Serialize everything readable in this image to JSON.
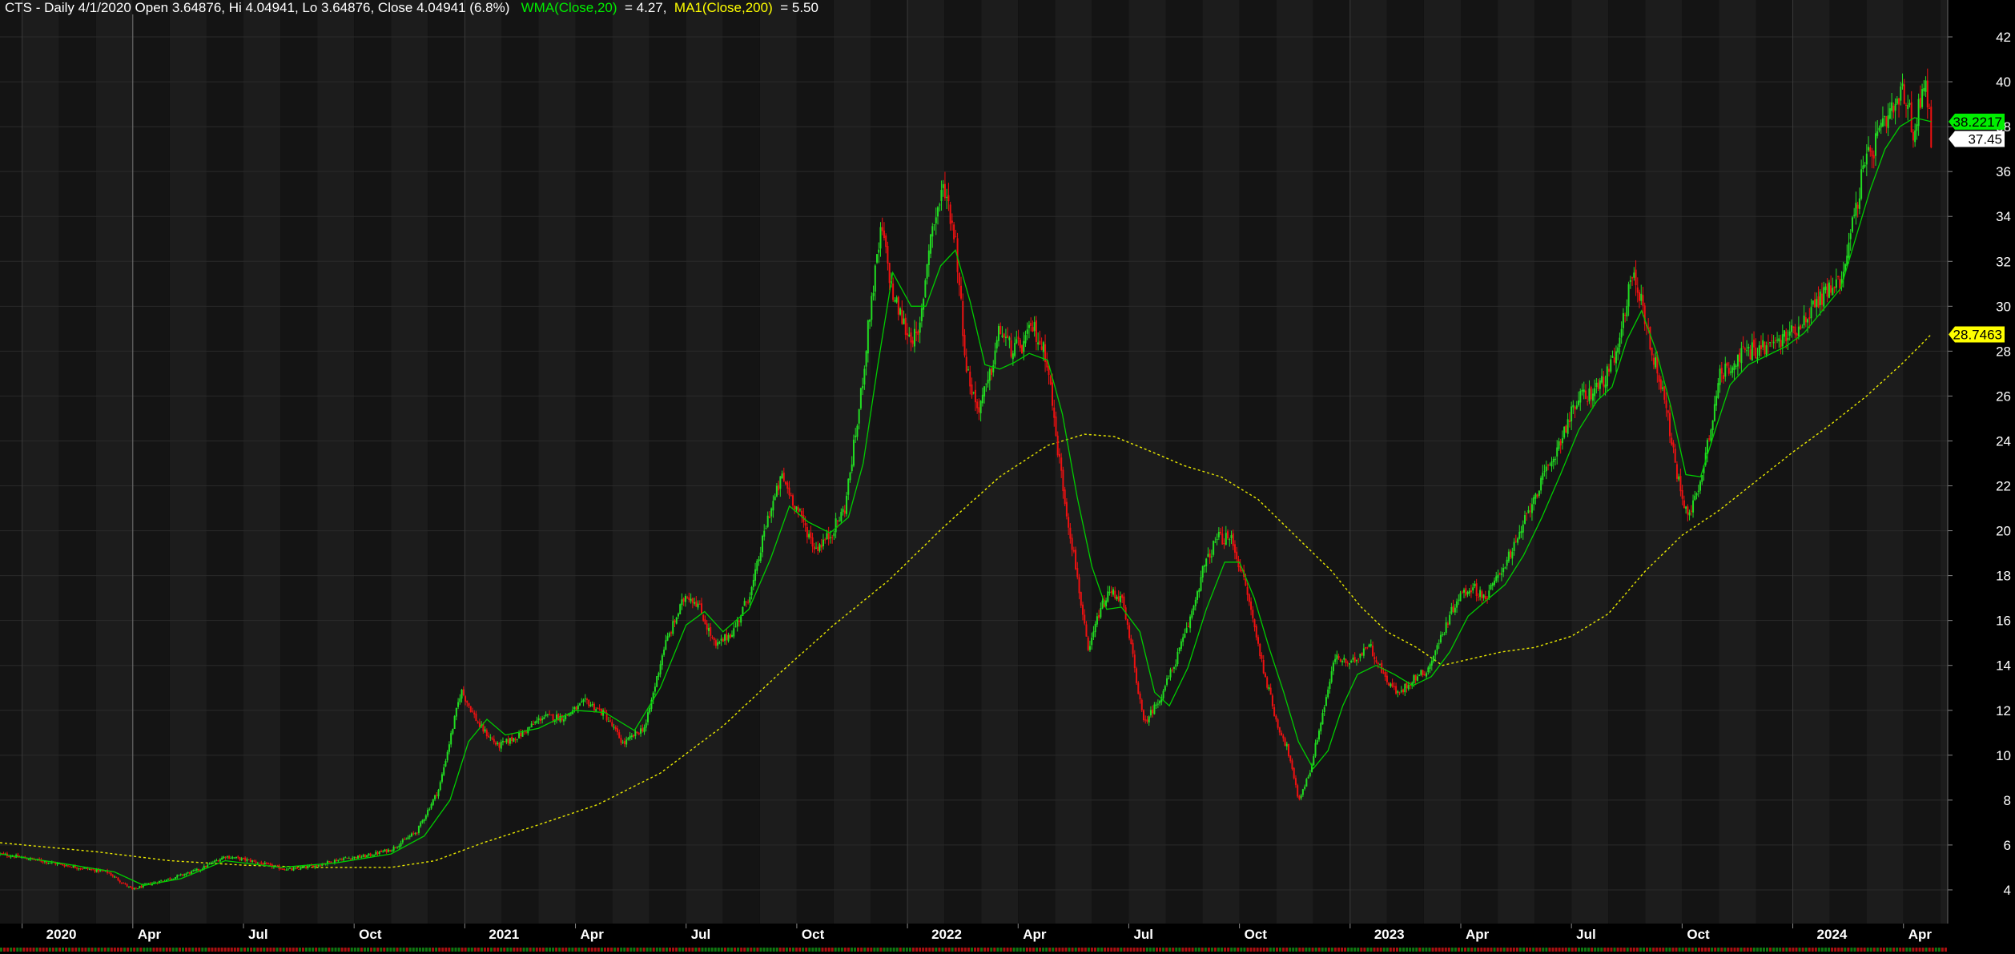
{
  "chart_data": {
    "type": "candlestick",
    "symbol": "CTS",
    "header": {
      "title": "CTS - Daily 4/1/2020 Open 3.64876, Hi 4.04941, Lo 3.64876, Close 4.04941 (6.8%)",
      "wma_label": "WMA(Close,20)",
      "wma_value": " = 4.27, ",
      "ma_label": "MA1(Close,200)",
      "ma_value": " = 5.50"
    },
    "y_ticks": [
      "4",
      "6",
      "8",
      "10",
      "12",
      "14",
      "16",
      "18",
      "20",
      "22",
      "24",
      "26",
      "28",
      "30",
      "32",
      "34",
      "36",
      "38",
      "40",
      "42"
    ],
    "ylim": [
      2.5,
      43
    ],
    "x_ticks": [
      {
        "label": "2020",
        "major": true,
        "t": 0
      },
      {
        "label": "Apr",
        "major": false,
        "t": 3
      },
      {
        "label": "Jul",
        "major": false,
        "t": 6
      },
      {
        "label": "Oct",
        "major": false,
        "t": 9
      },
      {
        "label": "2021",
        "major": true,
        "t": 12
      },
      {
        "label": "Apr",
        "major": false,
        "t": 15
      },
      {
        "label": "Jul",
        "major": false,
        "t": 18
      },
      {
        "label": "Oct",
        "major": false,
        "t": 21
      },
      {
        "label": "2022",
        "major": true,
        "t": 24
      },
      {
        "label": "Apr",
        "major": false,
        "t": 27
      },
      {
        "label": "Jul",
        "major": false,
        "t": 30
      },
      {
        "label": "Oct",
        "major": false,
        "t": 33
      },
      {
        "label": "2023",
        "major": true,
        "t": 36
      },
      {
        "label": "Apr",
        "major": false,
        "t": 39
      },
      {
        "label": "Jul",
        "major": false,
        "t": 42
      },
      {
        "label": "Oct",
        "major": false,
        "t": 45
      },
      {
        "label": "2024",
        "major": true,
        "t": 48
      },
      {
        "label": "Apr",
        "major": false,
        "t": 51
      }
    ],
    "t_range": [
      -0.6,
      52.2
    ],
    "price_path": [
      [
        -0.6,
        5.6
      ],
      [
        0.5,
        5.3
      ],
      [
        1.5,
        5.0
      ],
      [
        2.3,
        4.8
      ],
      [
        3.0,
        4.0
      ],
      [
        3.3,
        4.2
      ],
      [
        4.0,
        4.5
      ],
      [
        4.8,
        4.9
      ],
      [
        5.5,
        5.5
      ],
      [
        6.2,
        5.3
      ],
      [
        6.9,
        5.0
      ],
      [
        7.3,
        4.9
      ],
      [
        8.0,
        5.1
      ],
      [
        8.7,
        5.4
      ],
      [
        9.3,
        5.5
      ],
      [
        10.0,
        5.8
      ],
      [
        10.7,
        6.6
      ],
      [
        11.3,
        8.5
      ],
      [
        11.9,
        12.9
      ],
      [
        12.4,
        11.3
      ],
      [
        12.9,
        10.4
      ],
      [
        13.5,
        10.9
      ],
      [
        14.1,
        11.7
      ],
      [
        14.7,
        11.7
      ],
      [
        15.3,
        12.4
      ],
      [
        15.8,
        11.8
      ],
      [
        16.3,
        10.5
      ],
      [
        16.9,
        11.3
      ],
      [
        17.4,
        14.8
      ],
      [
        18.0,
        17.2
      ],
      [
        18.3,
        16.8
      ],
      [
        18.8,
        14.8
      ],
      [
        19.3,
        15.6
      ],
      [
        19.8,
        17.5
      ],
      [
        20.2,
        20.5
      ],
      [
        20.6,
        22.4
      ],
      [
        21.0,
        21.0
      ],
      [
        21.5,
        19.2
      ],
      [
        21.9,
        19.8
      ],
      [
        22.3,
        21.0
      ],
      [
        22.7,
        25.5
      ],
      [
        23.0,
        30.0
      ],
      [
        23.3,
        33.5
      ],
      [
        23.6,
        30.5
      ],
      [
        24.0,
        28.8
      ],
      [
        24.3,
        28.5
      ],
      [
        24.6,
        33.0
      ],
      [
        25.0,
        35.4
      ],
      [
        25.3,
        33.0
      ],
      [
        25.6,
        27.2
      ],
      [
        25.9,
        25.4
      ],
      [
        26.2,
        26.6
      ],
      [
        26.5,
        29.0
      ],
      [
        26.8,
        28.1
      ],
      [
        27.1,
        28.2
      ],
      [
        27.4,
        29.1
      ],
      [
        27.8,
        27.6
      ],
      [
        28.0,
        24.5
      ],
      [
        28.3,
        21.0
      ],
      [
        28.6,
        18.0
      ],
      [
        28.9,
        14.5
      ],
      [
        29.2,
        16.4
      ],
      [
        29.5,
        17.3
      ],
      [
        29.8,
        17.0
      ],
      [
        30.1,
        14.5
      ],
      [
        30.4,
        11.4
      ],
      [
        30.8,
        12.4
      ],
      [
        31.2,
        13.9
      ],
      [
        31.6,
        15.7
      ],
      [
        32.0,
        18.2
      ],
      [
        32.4,
        19.7
      ],
      [
        32.8,
        19.6
      ],
      [
        33.2,
        17.3
      ],
      [
        33.6,
        14.2
      ],
      [
        34.0,
        11.5
      ],
      [
        34.3,
        10.3
      ],
      [
        34.6,
        8.0
      ],
      [
        34.9,
        9.2
      ],
      [
        35.3,
        12.2
      ],
      [
        35.6,
        14.4
      ],
      [
        36.0,
        14.0
      ],
      [
        36.5,
        15.0
      ],
      [
        36.9,
        13.6
      ],
      [
        37.3,
        12.7
      ],
      [
        37.7,
        13.4
      ],
      [
        38.1,
        13.8
      ],
      [
        38.5,
        15.4
      ],
      [
        38.9,
        17.0
      ],
      [
        39.3,
        17.5
      ],
      [
        39.7,
        17.0
      ],
      [
        40.1,
        18.3
      ],
      [
        40.5,
        19.4
      ],
      [
        41.0,
        21.6
      ],
      [
        41.4,
        22.8
      ],
      [
        41.8,
        24.5
      ],
      [
        42.2,
        25.9
      ],
      [
        42.6,
        26.2
      ],
      [
        43.0,
        27.0
      ],
      [
        43.3,
        28.2
      ],
      [
        43.6,
        31.5
      ],
      [
        43.9,
        30.3
      ],
      [
        44.2,
        27.8
      ],
      [
        44.5,
        26.2
      ],
      [
        44.8,
        23.0
      ],
      [
        45.1,
        20.8
      ],
      [
        45.4,
        21.5
      ],
      [
        45.7,
        24.0
      ],
      [
        46.0,
        26.8
      ],
      [
        46.4,
        27.6
      ],
      [
        46.8,
        28.0
      ],
      [
        47.3,
        28.2
      ],
      [
        47.8,
        28.6
      ],
      [
        48.3,
        29.4
      ],
      [
        48.8,
        30.5
      ],
      [
        49.3,
        31.2
      ],
      [
        49.6,
        33.5
      ],
      [
        49.9,
        36.0
      ],
      [
        50.3,
        37.5
      ],
      [
        50.7,
        38.6
      ],
      [
        51.0,
        39.5
      ],
      [
        51.3,
        37.7
      ],
      [
        51.6,
        40.5
      ],
      [
        51.75,
        37.45
      ]
    ],
    "wma_path": [
      [
        -0.6,
        5.6
      ],
      [
        1.0,
        5.2
      ],
      [
        2.5,
        4.8
      ],
      [
        3.3,
        4.2
      ],
      [
        4.3,
        4.5
      ],
      [
        5.5,
        5.3
      ],
      [
        7.0,
        5.0
      ],
      [
        8.5,
        5.2
      ],
      [
        10.0,
        5.6
      ],
      [
        10.9,
        6.4
      ],
      [
        11.6,
        8.0
      ],
      [
        12.1,
        10.6
      ],
      [
        12.6,
        11.6
      ],
      [
        13.1,
        10.9
      ],
      [
        14.0,
        11.2
      ],
      [
        15.0,
        12.0
      ],
      [
        15.8,
        11.9
      ],
      [
        16.6,
        11.1
      ],
      [
        17.3,
        13.0
      ],
      [
        18.0,
        15.8
      ],
      [
        18.5,
        16.4
      ],
      [
        19.0,
        15.5
      ],
      [
        19.7,
        16.5
      ],
      [
        20.3,
        18.8
      ],
      [
        20.8,
        21.1
      ],
      [
        21.3,
        20.4
      ],
      [
        21.9,
        19.9
      ],
      [
        22.4,
        20.6
      ],
      [
        22.8,
        23.0
      ],
      [
        23.2,
        27.4
      ],
      [
        23.6,
        31.5
      ],
      [
        24.1,
        30.0
      ],
      [
        24.5,
        30.0
      ],
      [
        24.9,
        31.8
      ],
      [
        25.3,
        32.5
      ],
      [
        25.7,
        30.2
      ],
      [
        26.1,
        27.4
      ],
      [
        26.5,
        27.2
      ],
      [
        26.9,
        27.5
      ],
      [
        27.3,
        27.9
      ],
      [
        27.8,
        27.6
      ],
      [
        28.2,
        25.2
      ],
      [
        28.6,
        21.5
      ],
      [
        29.0,
        18.4
      ],
      [
        29.4,
        16.5
      ],
      [
        29.8,
        16.6
      ],
      [
        30.3,
        15.5
      ],
      [
        30.7,
        12.8
      ],
      [
        31.1,
        12.2
      ],
      [
        31.6,
        13.9
      ],
      [
        32.1,
        16.5
      ],
      [
        32.6,
        18.6
      ],
      [
        33.0,
        18.6
      ],
      [
        33.4,
        17.0
      ],
      [
        33.8,
        14.8
      ],
      [
        34.2,
        12.8
      ],
      [
        34.6,
        10.6
      ],
      [
        35.0,
        9.4
      ],
      [
        35.4,
        10.2
      ],
      [
        35.8,
        12.2
      ],
      [
        36.2,
        13.6
      ],
      [
        36.7,
        14.0
      ],
      [
        37.2,
        13.6
      ],
      [
        37.7,
        13.1
      ],
      [
        38.2,
        13.5
      ],
      [
        38.7,
        14.6
      ],
      [
        39.2,
        16.2
      ],
      [
        39.7,
        16.9
      ],
      [
        40.2,
        17.6
      ],
      [
        40.7,
        18.9
      ],
      [
        41.2,
        20.6
      ],
      [
        41.7,
        22.5
      ],
      [
        42.2,
        24.5
      ],
      [
        42.7,
        25.8
      ],
      [
        43.1,
        26.4
      ],
      [
        43.5,
        28.5
      ],
      [
        43.9,
        29.8
      ],
      [
        44.3,
        28.0
      ],
      [
        44.7,
        25.5
      ],
      [
        45.1,
        22.5
      ],
      [
        45.5,
        22.4
      ],
      [
        45.9,
        24.5
      ],
      [
        46.3,
        26.5
      ],
      [
        46.8,
        27.4
      ],
      [
        47.3,
        27.8
      ],
      [
        47.8,
        28.2
      ],
      [
        48.3,
        28.8
      ],
      [
        48.8,
        29.8
      ],
      [
        49.3,
        30.8
      ],
      [
        49.7,
        33.0
      ],
      [
        50.1,
        35.2
      ],
      [
        50.5,
        37.0
      ],
      [
        50.9,
        38.0
      ],
      [
        51.3,
        38.4
      ],
      [
        51.75,
        38.2217
      ]
    ],
    "ma_path": [
      [
        -0.6,
        6.1
      ],
      [
        2.0,
        5.7
      ],
      [
        4.0,
        5.3
      ],
      [
        6.0,
        5.1
      ],
      [
        8.0,
        5.0
      ],
      [
        10.0,
        5.0
      ],
      [
        11.2,
        5.3
      ],
      [
        12.5,
        6.1
      ],
      [
        14.0,
        6.9
      ],
      [
        15.6,
        7.8
      ],
      [
        17.3,
        9.2
      ],
      [
        19.0,
        11.3
      ],
      [
        20.5,
        13.6
      ],
      [
        22.0,
        15.8
      ],
      [
        23.5,
        17.8
      ],
      [
        25.0,
        20.2
      ],
      [
        26.5,
        22.4
      ],
      [
        27.8,
        23.8
      ],
      [
        28.8,
        24.3
      ],
      [
        29.6,
        24.2
      ],
      [
        30.5,
        23.6
      ],
      [
        31.5,
        22.9
      ],
      [
        32.5,
        22.4
      ],
      [
        33.5,
        21.4
      ],
      [
        34.5,
        19.8
      ],
      [
        35.5,
        18.2
      ],
      [
        36.3,
        16.6
      ],
      [
        37.0,
        15.5
      ],
      [
        37.8,
        14.8
      ],
      [
        38.5,
        14.0
      ],
      [
        39.3,
        14.3
      ],
      [
        40.1,
        14.6
      ],
      [
        41.0,
        14.8
      ],
      [
        42.0,
        15.3
      ],
      [
        43.0,
        16.3
      ],
      [
        44.0,
        18.2
      ],
      [
        45.0,
        19.8
      ],
      [
        46.0,
        20.9
      ],
      [
        47.0,
        22.2
      ],
      [
        48.0,
        23.5
      ],
      [
        49.0,
        24.7
      ],
      [
        50.0,
        26.0
      ],
      [
        51.0,
        27.5
      ],
      [
        51.75,
        28.7463
      ]
    ],
    "price_tags": [
      {
        "label": "38.2217",
        "value": 38.2217,
        "bg": "#00ee00",
        "fg": "#000000"
      },
      {
        "label": "37.45",
        "value": 37.45,
        "bg": "#ffffff",
        "fg": "#000000"
      },
      {
        "label": "28.7463",
        "value": 28.7463,
        "bg": "#ffff00",
        "fg": "#000000"
      }
    ],
    "colors": {
      "background": "#000000",
      "band_light": "#1c1c1c",
      "band_dark": "#141414",
      "grid": "#2a2a2a",
      "up": "#22dd22",
      "down": "#ee1111",
      "wma": "#00cc00",
      "ma": "#e8e800",
      "header_text": "#ffffff",
      "wma_text": "#00ee00",
      "ma_text": "#ffff00",
      "axis_text": "#ffffff"
    }
  }
}
